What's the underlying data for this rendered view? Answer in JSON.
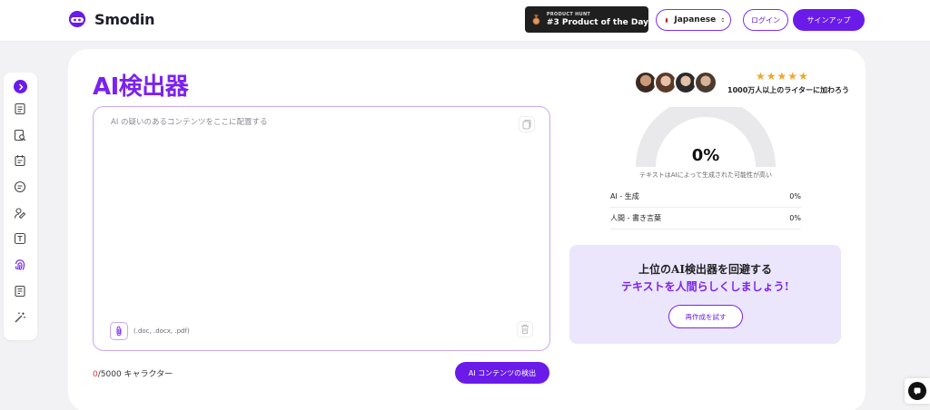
{
  "header": {
    "brand": "Smodin",
    "product_hunt": {
      "small": "PRODUCT HUNT",
      "big": "#3 Product of the Day"
    },
    "language": "Japanese",
    "login_label": "ログイン",
    "signup_label": "サインアップ"
  },
  "sidebar": {
    "items": [
      {
        "icon": "chevron-right-icon"
      },
      {
        "icon": "document-lines-icon"
      },
      {
        "icon": "document-search-icon"
      },
      {
        "icon": "document-edit-icon"
      },
      {
        "icon": "summary-icon"
      },
      {
        "icon": "user-pen-icon"
      },
      {
        "icon": "text-box-icon"
      },
      {
        "icon": "fingerprint-icon"
      },
      {
        "icon": "report-icon"
      },
      {
        "icon": "magic-wand-icon"
      }
    ]
  },
  "main": {
    "title": "AI検出器",
    "input_placeholder": "AI の疑いのあるコンテンツをここに配置する",
    "attach_types": "(.doc, .docx, .pdf)",
    "char_count_current": "0",
    "char_count_rest": "/5000 キャラクター",
    "detect_button": "AI コンテンツの検出"
  },
  "results": {
    "stars": "★★★★★",
    "join_text": "1000万人以上のライターに加わろう",
    "gauge_value": "0%",
    "gauge_caption": "テキストはAIによって生成された可能性が高い",
    "rows": [
      {
        "label": "AI - 生成",
        "value": "0%"
      },
      {
        "label": "人間 - 書き言葉",
        "value": "0%"
      }
    ]
  },
  "promo": {
    "line1": "上位のAI検出器を回避する",
    "line2": "テキストを人間らしくしましょう!",
    "button": "再作成を試す"
  },
  "colors": {
    "accent": "#6a1be9",
    "title": "#7b22f0",
    "promo_bg": "#ebe6fb",
    "star": "#f5a623"
  }
}
